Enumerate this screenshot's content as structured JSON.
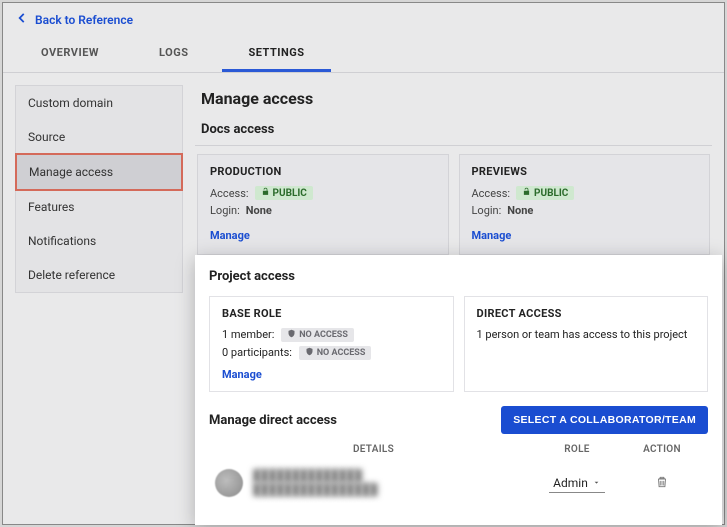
{
  "back": {
    "label": "Back to Reference"
  },
  "tabs": [
    {
      "label": "OVERVIEW",
      "active": false
    },
    {
      "label": "LOGS",
      "active": false
    },
    {
      "label": "SETTINGS",
      "active": true
    }
  ],
  "sidebar": {
    "items": [
      {
        "label": "Custom domain"
      },
      {
        "label": "Source"
      },
      {
        "label": "Manage access",
        "active": true
      },
      {
        "label": "Features"
      },
      {
        "label": "Notifications"
      },
      {
        "label": "Delete reference"
      }
    ]
  },
  "main": {
    "title": "Manage access",
    "docs": {
      "heading": "Docs access",
      "cards": [
        {
          "title": "PRODUCTION",
          "access_label": "Access:",
          "access_badge": "PUBLIC",
          "login_label": "Login:",
          "login_value": "None",
          "manage": "Manage"
        },
        {
          "title": "PREVIEWS",
          "access_label": "Access:",
          "access_badge": "PUBLIC",
          "login_label": "Login:",
          "login_value": "None",
          "manage": "Manage"
        }
      ]
    },
    "project": {
      "heading": "Project access",
      "base_role": {
        "title": "BASE ROLE",
        "member_line": "1 member:",
        "participants_line": "0 participants:",
        "no_access_badge": "NO ACCESS",
        "manage": "Manage"
      },
      "direct_access": {
        "title": "DIRECT ACCESS",
        "summary": "1 person or team has access to this project"
      }
    },
    "direct": {
      "heading": "Manage direct access",
      "select_button": "SELECT A COLLABORATOR/TEAM",
      "columns": {
        "details": "DETAILS",
        "role": "ROLE",
        "action": "ACTION"
      },
      "rows": [
        {
          "name": "██████████████",
          "email": "████████████████",
          "role": "Admin"
        }
      ]
    }
  }
}
